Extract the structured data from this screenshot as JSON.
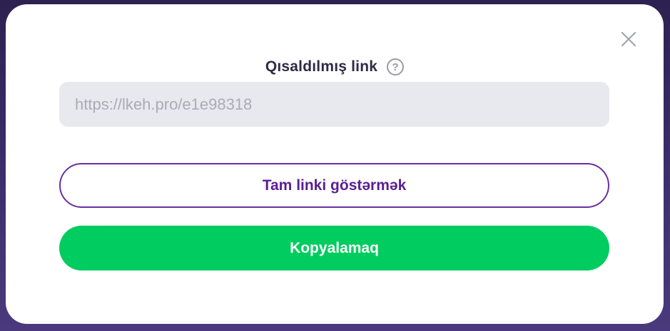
{
  "dialog": {
    "title": "Qısaldılmış link",
    "help_icon_glyph": "?",
    "short_link_value": "https://lkeh.pro/e1e98318",
    "show_full_link_label": "Tam linki göstərmək",
    "copy_label": "Kopyalamaq",
    "close_icon": "close-icon",
    "help_icon": "question-circle-icon"
  },
  "colors": {
    "accent_purple": "#5a1f92",
    "primary_green": "#00cc5f",
    "field_background": "#e8e9ee"
  }
}
